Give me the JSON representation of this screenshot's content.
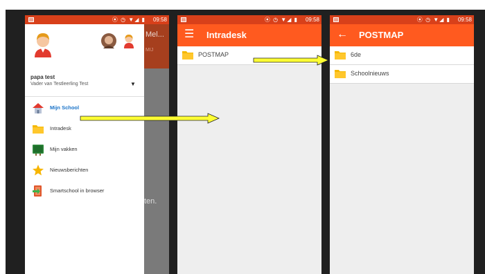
{
  "status_bar": {
    "time": "09:58",
    "icons": "⦿ ◷ ▼◢ ▮"
  },
  "drawer_screen": {
    "user": {
      "name": "papa test",
      "subtitle": "Vader van Testleerling Test"
    },
    "behind": {
      "title": "Mel...",
      "subtitle": "MIJ",
      "text": "ten."
    },
    "menu": [
      {
        "label": "Mijn School",
        "icon": "house-icon",
        "active": true
      },
      {
        "label": "Intradesk",
        "icon": "folder-icon",
        "active": false
      },
      {
        "label": "Mijn vakken",
        "icon": "board-icon",
        "active": false
      },
      {
        "label": "Nieuwsberichten",
        "icon": "star-icon",
        "active": false
      },
      {
        "label": "Smartschool in browser",
        "icon": "browser-exit-icon",
        "active": false
      }
    ]
  },
  "intradesk_screen": {
    "title": "Intradesk",
    "items": [
      {
        "label": "POSTMAP"
      }
    ]
  },
  "postmap_screen": {
    "title": "POSTMAP",
    "items": [
      {
        "label": "6de"
      },
      {
        "label": "Schoolnieuws"
      }
    ]
  },
  "colors": {
    "appbar": "#ff5a1f",
    "statusbar": "#d8401a",
    "arrow": "#ffff33",
    "folder": "#f5b800",
    "active_link": "#1a73c8"
  }
}
